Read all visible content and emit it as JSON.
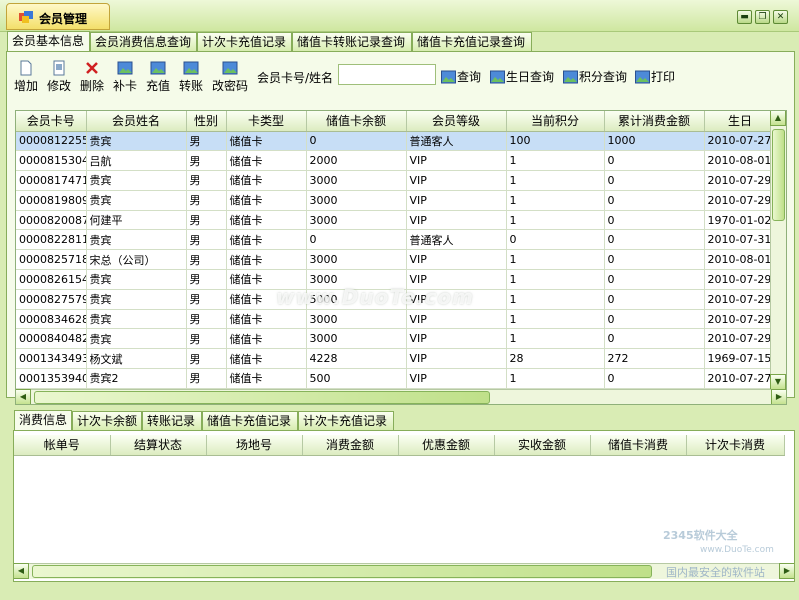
{
  "app": {
    "title": "会员管理"
  },
  "window_buttons": [
    "minimize",
    "restore",
    "close"
  ],
  "top_tabs": [
    {
      "label": "会员基本信息",
      "active": true
    },
    {
      "label": "会员消费信息查询"
    },
    {
      "label": "计次卡充值记录"
    },
    {
      "label": "储值卡转账记录查询"
    },
    {
      "label": "储值卡充值记录查询"
    }
  ],
  "toolbar": {
    "add_label": "增加",
    "edit_label": "修改",
    "delete_label": "删除",
    "reissue_label": "补卡",
    "recharge_label": "充值",
    "transfer_label": "转账",
    "password_label": "改密码",
    "search_label": "会员卡号/姓名",
    "search_value": "",
    "query_label": "查询",
    "birthday_label": "生日查询",
    "points_label": "积分查询",
    "print_label": "打印"
  },
  "members_table": {
    "headers": [
      "会员卡号",
      "会员姓名",
      "性别",
      "卡类型",
      "储值卡余额",
      "会员等级",
      "当前积分",
      "累计消费金额",
      "生日"
    ],
    "rows": [
      [
        "0000812255",
        "贵宾",
        "男",
        "储值卡",
        "0",
        "普通客人",
        "100",
        "1000",
        "2010-07-27"
      ],
      [
        "0000815304",
        "吕航",
        "男",
        "储值卡",
        "2000",
        "VIP",
        "1",
        "0",
        "2010-08-01"
      ],
      [
        "0000817471",
        "贵宾",
        "男",
        "储值卡",
        "3000",
        "VIP",
        "1",
        "0",
        "2010-07-29"
      ],
      [
        "0000819809",
        "贵宾",
        "男",
        "储值卡",
        "3000",
        "VIP",
        "1",
        "0",
        "2010-07-29"
      ],
      [
        "0000820087",
        "何建平",
        "男",
        "储值卡",
        "3000",
        "VIP",
        "1",
        "0",
        "1970-01-02"
      ],
      [
        "0000822811",
        "贵宾",
        "男",
        "储值卡",
        "0",
        "普通客人",
        "0",
        "0",
        "2010-07-31"
      ],
      [
        "0000825718",
        "宋总（公司）",
        "男",
        "储值卡",
        "3000",
        "VIP",
        "1",
        "0",
        "2010-08-01"
      ],
      [
        "0000826154",
        "贵宾",
        "男",
        "储值卡",
        "3000",
        "VIP",
        "1",
        "0",
        "2010-07-29"
      ],
      [
        "0000827579",
        "贵宾",
        "男",
        "储值卡",
        "5000",
        "VIP",
        "1",
        "0",
        "2010-07-29"
      ],
      [
        "0000834628",
        "贵宾",
        "男",
        "储值卡",
        "3000",
        "VIP",
        "1",
        "0",
        "2010-07-29"
      ],
      [
        "0000840482",
        "贵宾",
        "男",
        "储值卡",
        "3000",
        "VIP",
        "1",
        "0",
        "2010-07-29"
      ],
      [
        "0001343493",
        "杨文斌",
        "男",
        "储值卡",
        "4228",
        "VIP",
        "28",
        "272",
        "1969-07-15"
      ],
      [
        "0001353940",
        "贵宾2",
        "男",
        "储值卡",
        "500",
        "VIP",
        "1",
        "0",
        "2010-07-27"
      ]
    ],
    "selected_row": 0
  },
  "bottom_tabs": [
    {
      "label": "消费信息",
      "active": true
    },
    {
      "label": "计次卡余额"
    },
    {
      "label": "转账记录"
    },
    {
      "label": "储值卡充值记录"
    },
    {
      "label": "计次卡充值记录"
    }
  ],
  "consumption_table": {
    "headers": [
      "帐单号",
      "结算状态",
      "场地号",
      "消费金额",
      "优惠金额",
      "实收金额",
      "储值卡消费",
      "计次卡消费"
    ]
  },
  "watermarks": {
    "center": "www.DuoTe.com",
    "corner_brand": "2345软件大全",
    "corner_url": "www.DuoTe.com",
    "corner_slogan": "国内最安全的软件站"
  },
  "colors": {
    "background": "#d9ecb4",
    "selected_row": "#c7def6",
    "title_tab": "#f3df6a"
  }
}
